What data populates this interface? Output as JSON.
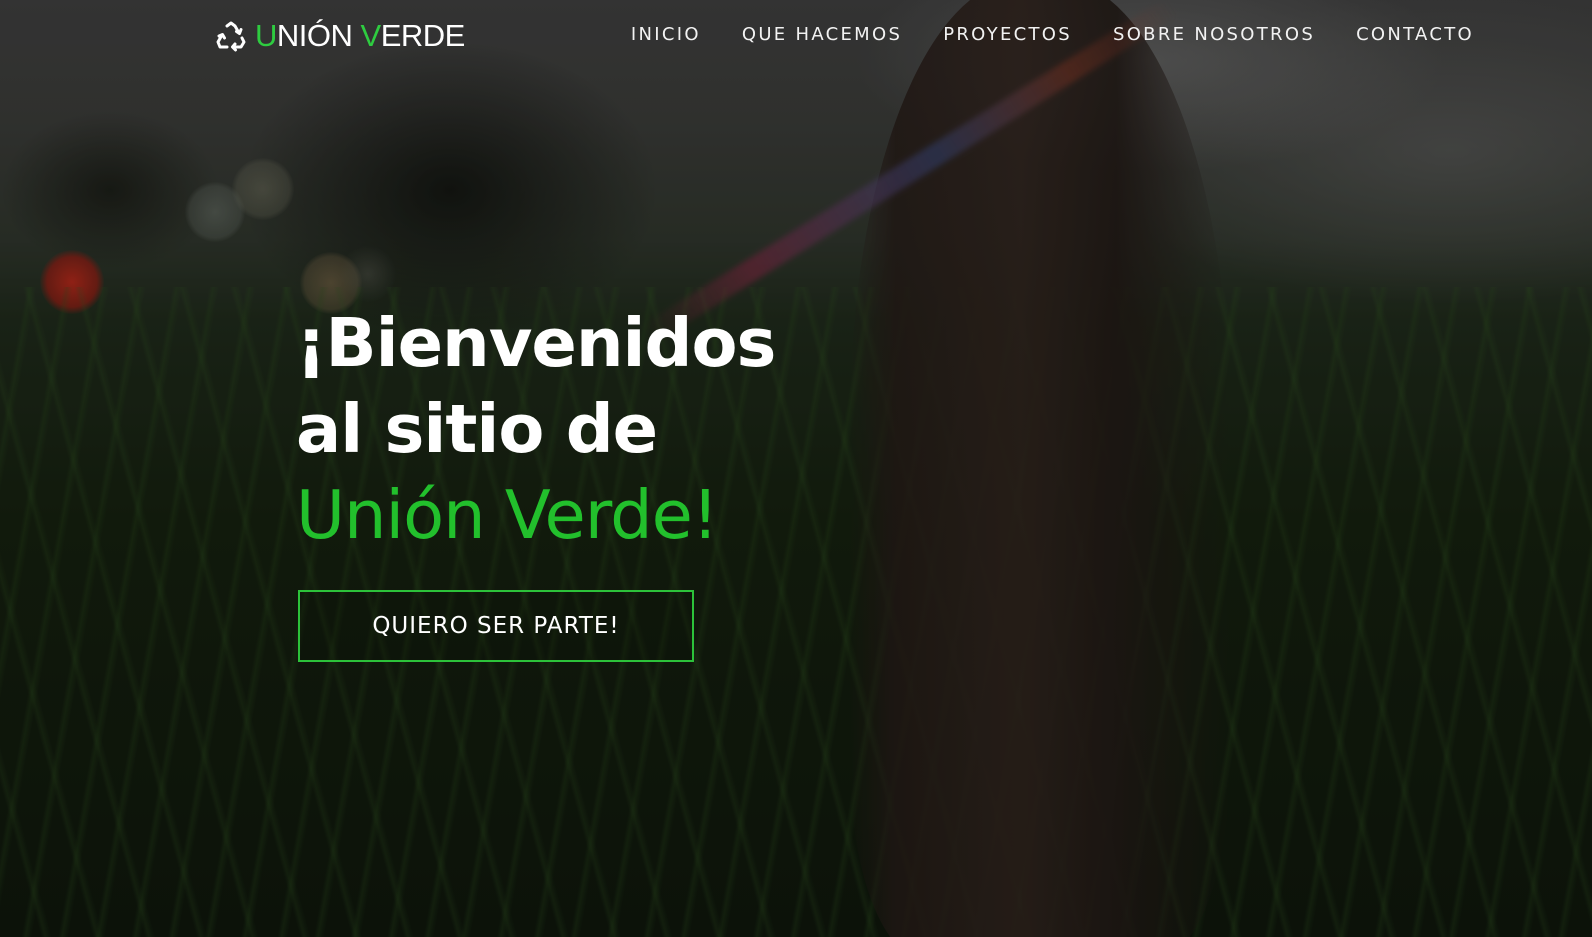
{
  "brand": {
    "icon": "recycle-icon",
    "name_parts": [
      {
        "text": "U",
        "accent": true
      },
      {
        "text": "NIÓN ",
        "accent": false
      },
      {
        "text": "V",
        "accent": true
      },
      {
        "text": "ERDE",
        "accent": false
      }
    ]
  },
  "nav": {
    "items": [
      "INICIO",
      "QUE HACEMOS",
      "PROYECTOS",
      "SOBRE NOSOTROS",
      "CONTACTO"
    ]
  },
  "hero": {
    "line1": "¡Bienvenidos",
    "line2": "al sitio de",
    "line3": "Unión Verde!",
    "cta_label": "QUIERO SER PARTE!"
  },
  "colors": {
    "accent": "#2ecc40",
    "text": "#ffffff"
  }
}
